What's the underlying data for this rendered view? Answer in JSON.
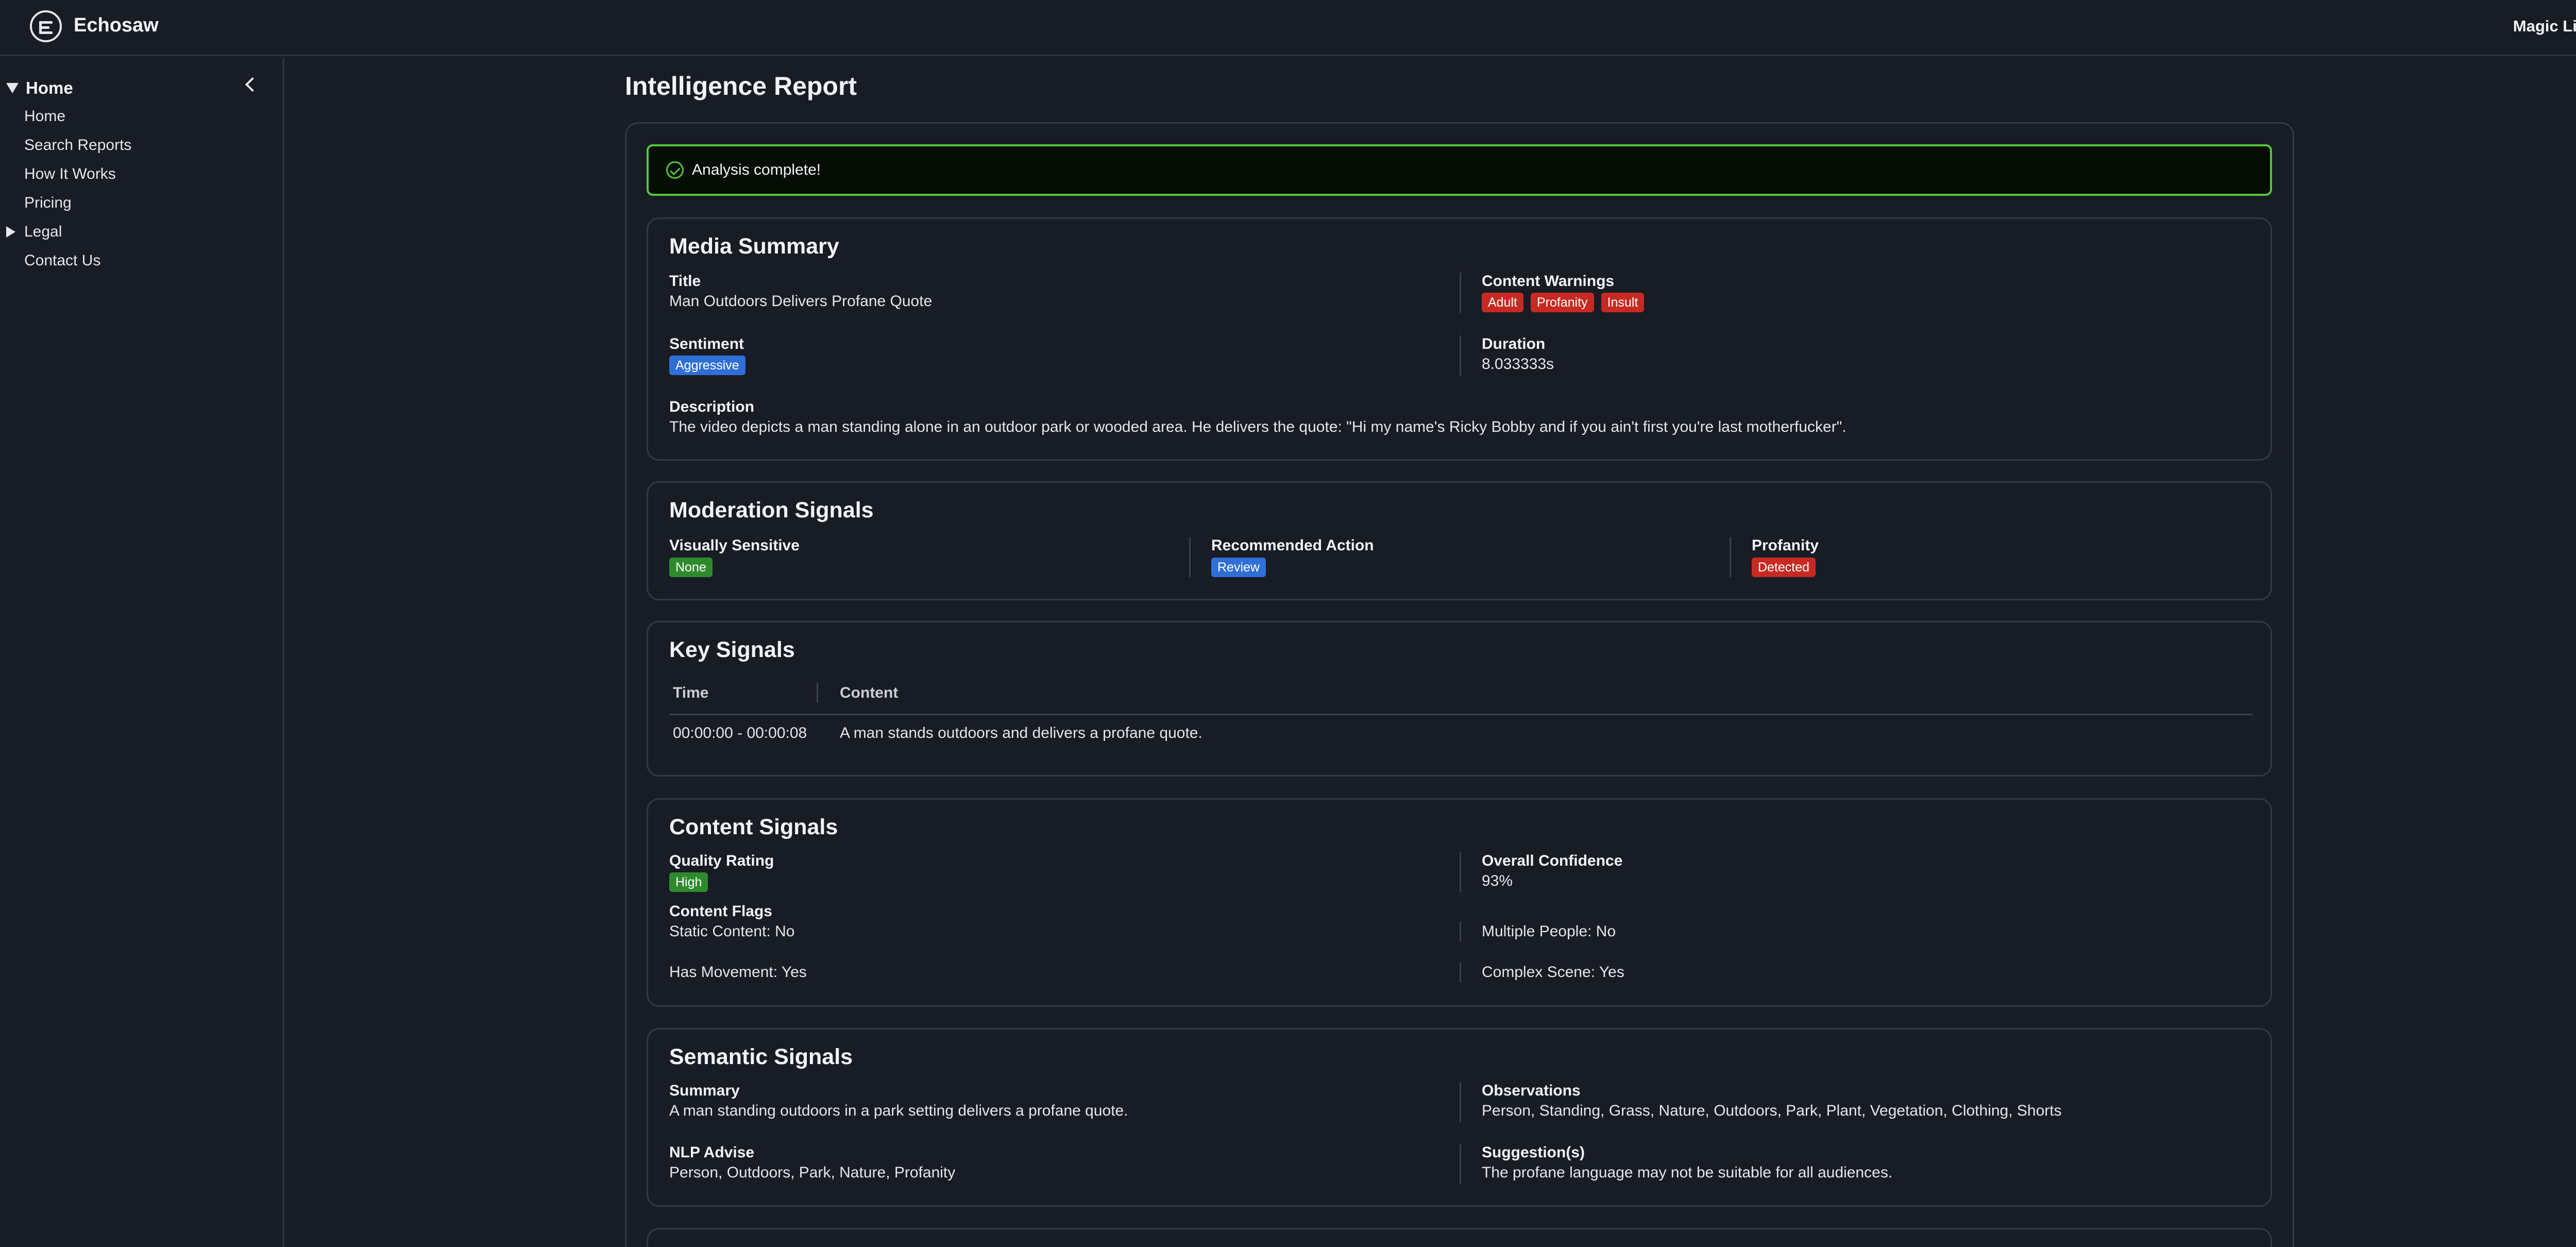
{
  "header": {
    "brand": "Echosaw",
    "magic_link": "Magic Link"
  },
  "sidebar": {
    "home_group": "Home",
    "items": [
      "Home",
      "Search Reports",
      "How It Works",
      "Pricing"
    ],
    "legal": "Legal",
    "contact": "Contact Us"
  },
  "page": {
    "title": "Intelligence Report",
    "alert": "Analysis complete!"
  },
  "media_summary": {
    "title": "Media Summary",
    "title_label": "Title",
    "title_value": "Man Outdoors Delivers Profane Quote",
    "warnings_label": "Content Warnings",
    "warnings": [
      "Adult",
      "Profanity",
      "Insult"
    ],
    "sentiment_label": "Sentiment",
    "sentiment": "Aggressive",
    "duration_label": "Duration",
    "duration": "8.033333s",
    "description_label": "Description",
    "description": "The video depicts a man standing alone in an outdoor park or wooded area. He delivers the quote: \"Hi my name's Ricky Bobby and if you ain't first you're last motherfucker\"."
  },
  "moderation": {
    "title": "Moderation Signals",
    "visual_label": "Visually Sensitive",
    "visual": "None",
    "action_label": "Recommended Action",
    "action": "Review",
    "profanity_label": "Profanity",
    "profanity": "Detected"
  },
  "key_signals": {
    "title": "Key Signals",
    "columns": [
      "Time",
      "Content"
    ],
    "rows": [
      {
        "time": "00:00:00 - 00:00:08",
        "content": "A man stands outdoors and delivers a profane quote."
      }
    ]
  },
  "content_signals": {
    "title": "Content Signals",
    "quality_label": "Quality Rating",
    "quality": "High",
    "confidence_label": "Overall Confidence",
    "confidence": "93%",
    "flags_label": "Content Flags",
    "static": "Static Content: No",
    "multiple": "Multiple People: No",
    "movement": "Has Movement: Yes",
    "complex": "Complex Scene: Yes"
  },
  "semantic": {
    "title": "Semantic Signals",
    "summary_label": "Summary",
    "summary": "A man standing outdoors in a park setting delivers a profane quote.",
    "observations_label": "Observations",
    "observations": "Person, Standing, Grass, Nature, Outdoors, Park, Plant, Vegetation, Clothing, Shorts",
    "nlp_label": "NLP Advise",
    "nlp": "Person, Outdoors, Park, Nature, Profanity",
    "suggestions_label": "Suggestion(s)",
    "suggestions": "The profane language may not be suitable for all audiences."
  },
  "colors": {
    "background": "#181c25",
    "success": "#53c83c",
    "badge_red": "#c72a22",
    "badge_blue": "#2f6fd6",
    "badge_green": "#2e8b2c"
  }
}
